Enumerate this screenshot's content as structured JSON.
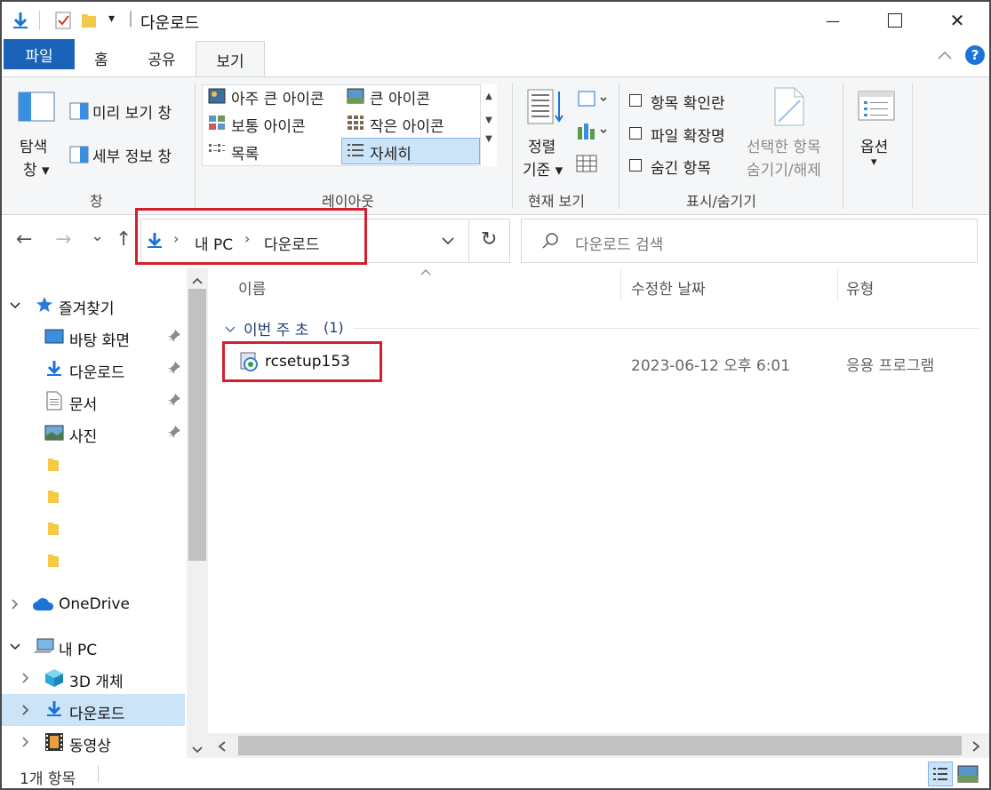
{
  "window": {
    "title": "다운로드",
    "minimize_glyph": "—",
    "maximize_glyph": "☐",
    "close_glyph": "✕"
  },
  "quick_access_toolbar": {
    "dropdown_glyph": "▾",
    "separator": "|"
  },
  "tabs": {
    "file": "파일",
    "home": "홈",
    "share": "공유",
    "view": "보기",
    "collapse_glyph": "︿",
    "help_glyph": "?"
  },
  "ribbon": {
    "pane": {
      "nav_pane_label_1": "탐색",
      "nav_pane_label_2": "창 ▾",
      "preview_pane": "미리 보기 창",
      "details_pane": "세부 정보 창",
      "group_label": "창"
    },
    "layout": {
      "items": [
        "아주 큰 아이콘",
        "큰 아이콘",
        "보통 아이콘",
        "작은 아이콘",
        "목록",
        "자세히"
      ],
      "selected": "자세히",
      "group_label": "레이아웃"
    },
    "current_view": {
      "sort_label_1": "정렬",
      "sort_label_2": "기준 ▾",
      "group_label": "현재 보기"
    },
    "show_hide": {
      "item_checkboxes": "항목 확인란",
      "file_extensions": "파일 확장명",
      "hidden_items": "숨긴 항목",
      "hide_selected_1": "선택한 항목",
      "hide_selected_2": "숨기기/해제",
      "group_label": "표시/숨기기"
    },
    "options": {
      "label": "옵션",
      "arrow": "▾"
    }
  },
  "address_bar": {
    "breadcrumb": [
      "내 PC",
      "다운로드"
    ],
    "separator": "›",
    "dropdown_glyph": "⌄",
    "refresh_glyph": "↻"
  },
  "search": {
    "placeholder": "다운로드 검색"
  },
  "nav_buttons": {
    "back": "←",
    "forward": "→",
    "recent": "⌄",
    "up": "↑"
  },
  "sidebar": {
    "quick_access": "즐겨찾기",
    "quick_items": [
      "바탕 화면",
      "다운로드",
      "문서",
      "사진"
    ],
    "onedrive": "OneDrive",
    "this_pc": "내 PC",
    "pc_items": [
      "3D 개체",
      "다운로드",
      "동영상"
    ],
    "selected": "다운로드",
    "scroll_up": "▲",
    "scroll_down": "▼"
  },
  "file_list": {
    "columns": {
      "name": "이름",
      "modified": "수정한 날짜",
      "type": "유형"
    },
    "sort_glyph": "^",
    "group": {
      "label": "이번 주 초",
      "count": "(1)"
    },
    "rows": [
      {
        "name": "rcsetup153",
        "modified": "2023-06-12 오후 6:01",
        "type": "응용 프로그램"
      }
    ],
    "hscroll_left": "<",
    "hscroll_right": ">"
  },
  "status_bar": {
    "item_count": "1개 항목"
  },
  "colors": {
    "accent": "#1a63b8",
    "selection": "#cce4f7",
    "highlight_box": "#d4202c",
    "ribbon_bg": "#f5f6f7"
  }
}
